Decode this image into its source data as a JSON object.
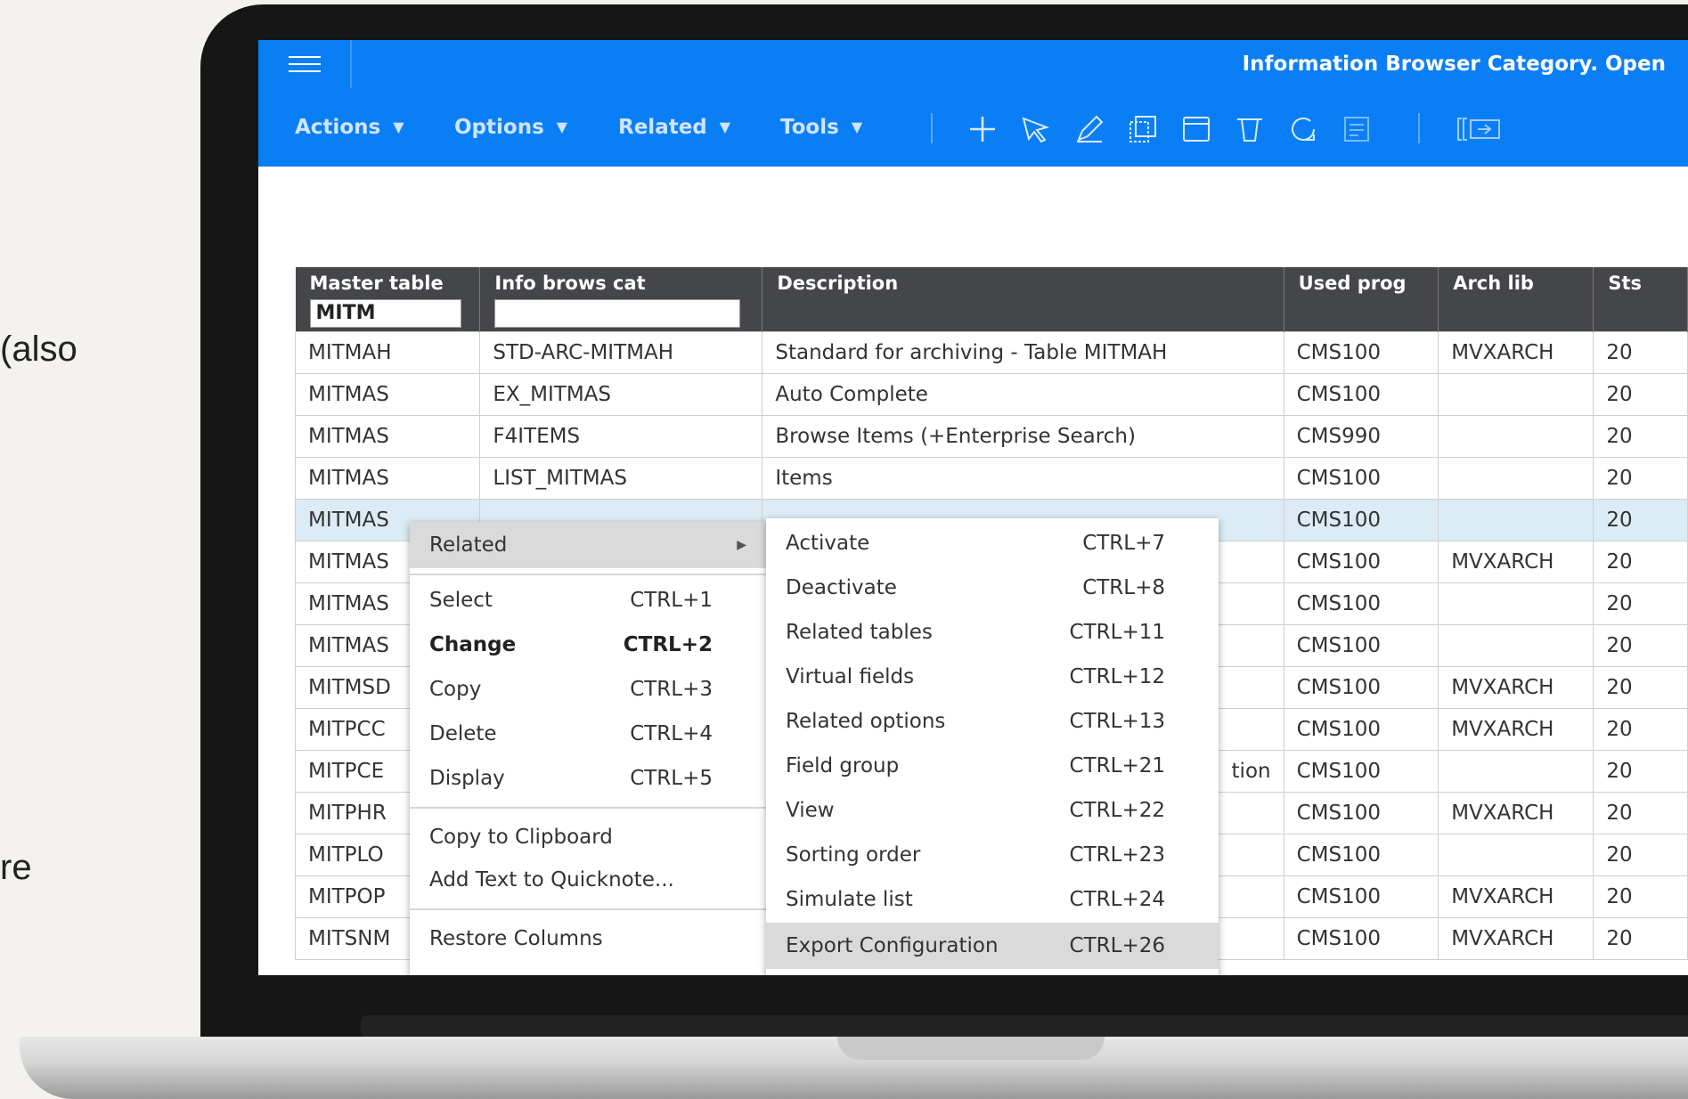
{
  "slide": {
    "fragment1": "(also",
    "fragment2": "re"
  },
  "app": {
    "title": "Information Browser Category. Open"
  },
  "menus": [
    "Actions",
    "Options",
    "Related",
    "Tools"
  ],
  "toolbar_icons": [
    "plus-icon",
    "select-arrow-icon",
    "edit-pencil-icon",
    "copy-icon",
    "display-icon",
    "delete-bin-icon",
    "refresh-icon",
    "notes-icon",
    "column-layout-icon"
  ],
  "table": {
    "columns": [
      "Master table",
      "Info brows cat",
      "Description",
      "Used prog",
      "Arch lib",
      "Sts"
    ],
    "filters": {
      "master_table": "MITM",
      "info_brows_cat": ""
    },
    "rows": [
      [
        "MITMAH",
        "STD-ARC-MITMAH",
        "Standard for archiving - Table MITMAH",
        "CMS100",
        "MVXARCH",
        "20"
      ],
      [
        "MITMAS",
        "EX_MITMAS",
        "Auto Complete",
        "CMS100",
        "",
        "20"
      ],
      [
        "MITMAS",
        "F4ITEMS",
        "Browse Items (+Enterprise Search)",
        "CMS990",
        "",
        "20"
      ],
      [
        "MITMAS",
        "LIST_MITMAS",
        "Items",
        "CMS100",
        "",
        "20"
      ],
      [
        "MITMAS",
        "",
        "",
        "CMS100",
        "",
        "20"
      ],
      [
        "MITMAS",
        "",
        "",
        "CMS100",
        "MVXARCH",
        "20"
      ],
      [
        "MITMAS",
        "",
        "",
        "CMS100",
        "",
        "20"
      ],
      [
        "MITMAS",
        "",
        "",
        "CMS100",
        "",
        "20"
      ],
      [
        "MITMSD",
        "",
        "",
        "CMS100",
        "MVXARCH",
        "20"
      ],
      [
        "MITPCC",
        "",
        "",
        "CMS100",
        "MVXARCH",
        "20"
      ],
      [
        "MITPCE",
        "",
        "tion",
        "CMS100",
        "",
        "20"
      ],
      [
        "MITPHR",
        "",
        "",
        "CMS100",
        "MVXARCH",
        "20"
      ],
      [
        "MITPLO",
        "",
        "",
        "CMS100",
        "",
        "20"
      ],
      [
        "MITPOP",
        "",
        "",
        "CMS100",
        "MVXARCH",
        "20"
      ],
      [
        "MITSNM",
        "",
        "",
        "CMS100",
        "MVXARCH",
        "20"
      ]
    ]
  },
  "context_menu": {
    "related": "Related",
    "items": [
      {
        "label": "Select",
        "key": "CTRL+1"
      },
      {
        "label": "Change",
        "key": "CTRL+2"
      },
      {
        "label": "Copy",
        "key": "CTRL+3"
      },
      {
        "label": "Delete",
        "key": "CTRL+4"
      },
      {
        "label": "Display",
        "key": "CTRL+5"
      }
    ],
    "copy_clipboard": "Copy to Clipboard",
    "add_quicknote": "Add Text to Quicknote...",
    "restore_columns": "Restore Columns"
  },
  "submenu": {
    "items": [
      {
        "label": "Activate",
        "key": "CTRL+7"
      },
      {
        "label": "Deactivate",
        "key": "CTRL+8"
      },
      {
        "label": "Related tables",
        "key": "CTRL+11"
      },
      {
        "label": "Virtual fields",
        "key": "CTRL+12"
      },
      {
        "label": "Related options",
        "key": "CTRL+13"
      },
      {
        "label": "Field group",
        "key": "CTRL+21"
      },
      {
        "label": "View",
        "key": "CTRL+22"
      },
      {
        "label": "Sorting order",
        "key": "CTRL+23"
      },
      {
        "label": "Simulate list",
        "key": "CTRL+24"
      },
      {
        "label": "Export Configuration",
        "key": "CTRL+26"
      }
    ]
  }
}
